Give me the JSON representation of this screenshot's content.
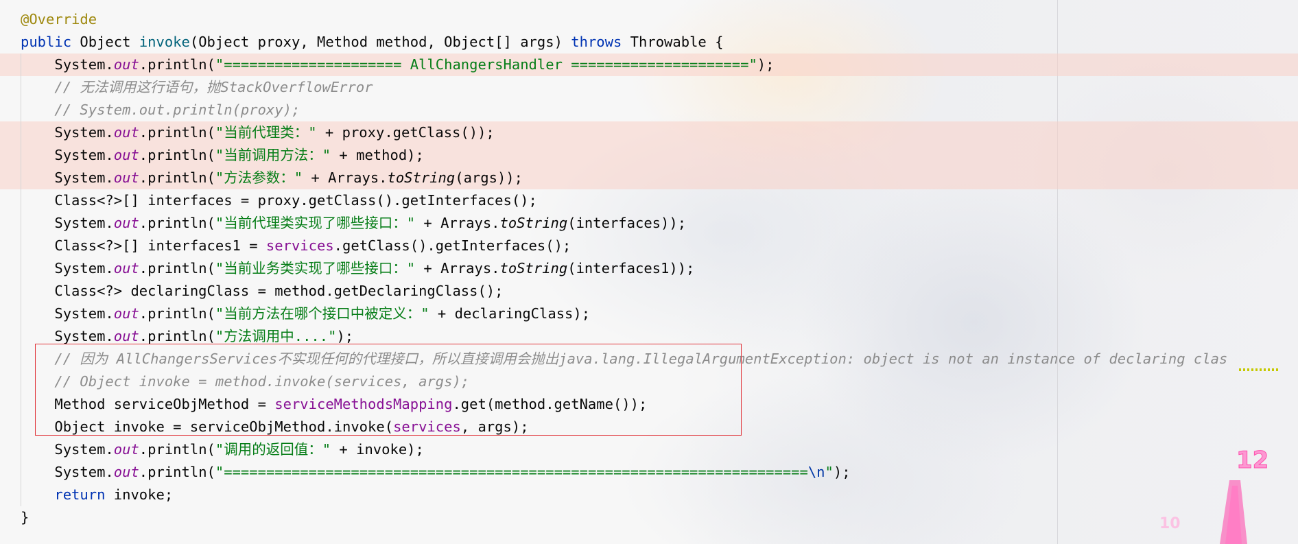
{
  "editor": {
    "lines": [
      {
        "highlighted": false,
        "tokens": [
          {
            "t": "@Override",
            "k": "ann"
          }
        ]
      },
      {
        "highlighted": false,
        "tokens": [
          {
            "t": "public",
            "k": "kw"
          },
          {
            "t": " Object ",
            "k": ""
          },
          {
            "t": "invoke",
            "k": "fn"
          },
          {
            "t": "(Object proxy, Method method, Object[] args) ",
            "k": ""
          },
          {
            "t": "throws",
            "k": "kw"
          },
          {
            "t": " Throwable {",
            "k": ""
          }
        ]
      },
      {
        "highlighted": true,
        "tokens": [
          {
            "t": "    System.",
            "k": ""
          },
          {
            "t": "out",
            "k": "static"
          },
          {
            "t": ".println(",
            "k": ""
          },
          {
            "t": "\"===================== AllChangersHandler =====================\"",
            "k": "str"
          },
          {
            "t": ");",
            "k": ""
          }
        ]
      },
      {
        "highlighted": false,
        "tokens": [
          {
            "t": "    // 无法调用这行语句，抛StackOverflowError",
            "k": "comment"
          }
        ]
      },
      {
        "highlighted": false,
        "tokens": [
          {
            "t": "    // System.out.println(proxy);",
            "k": "comment"
          }
        ]
      },
      {
        "highlighted": true,
        "tokens": [
          {
            "t": "    System.",
            "k": ""
          },
          {
            "t": "out",
            "k": "static"
          },
          {
            "t": ".println(",
            "k": ""
          },
          {
            "t": "\"当前代理类：\"",
            "k": "str"
          },
          {
            "t": " + proxy.getClass());",
            "k": ""
          }
        ]
      },
      {
        "highlighted": true,
        "tokens": [
          {
            "t": "    System.",
            "k": ""
          },
          {
            "t": "out",
            "k": "static"
          },
          {
            "t": ".println(",
            "k": ""
          },
          {
            "t": "\"当前调用方法：\"",
            "k": "str"
          },
          {
            "t": " + method);",
            "k": ""
          }
        ]
      },
      {
        "highlighted": true,
        "tokens": [
          {
            "t": "    System.",
            "k": ""
          },
          {
            "t": "out",
            "k": "static"
          },
          {
            "t": ".println(",
            "k": ""
          },
          {
            "t": "\"方法参数：\"",
            "k": "str"
          },
          {
            "t": " + Arrays.",
            "k": ""
          },
          {
            "t": "toString",
            "k": "smeth"
          },
          {
            "t": "(args));",
            "k": ""
          }
        ]
      },
      {
        "highlighted": false,
        "tokens": [
          {
            "t": "    Class<?>[] interfaces = proxy.getClass().getInterfaces();",
            "k": ""
          }
        ]
      },
      {
        "highlighted": false,
        "tokens": [
          {
            "t": "    System.",
            "k": ""
          },
          {
            "t": "out",
            "k": "static"
          },
          {
            "t": ".println(",
            "k": ""
          },
          {
            "t": "\"当前代理类实现了哪些接口：\"",
            "k": "str"
          },
          {
            "t": " + Arrays.",
            "k": ""
          },
          {
            "t": "toString",
            "k": "smeth"
          },
          {
            "t": "(interfaces));",
            "k": ""
          }
        ]
      },
      {
        "highlighted": false,
        "tokens": [
          {
            "t": "    Class<?>[] interfaces1 = ",
            "k": ""
          },
          {
            "t": "services",
            "k": "field"
          },
          {
            "t": ".getClass().getInterfaces();",
            "k": ""
          }
        ]
      },
      {
        "highlighted": false,
        "tokens": [
          {
            "t": "    System.",
            "k": ""
          },
          {
            "t": "out",
            "k": "static"
          },
          {
            "t": ".println(",
            "k": ""
          },
          {
            "t": "\"当前业务类实现了哪些接口：\"",
            "k": "str"
          },
          {
            "t": " + Arrays.",
            "k": ""
          },
          {
            "t": "toString",
            "k": "smeth"
          },
          {
            "t": "(interfaces1));",
            "k": ""
          }
        ]
      },
      {
        "highlighted": false,
        "tokens": [
          {
            "t": "    Class<?> declaringClass = method.getDeclaringClass();",
            "k": ""
          }
        ]
      },
      {
        "highlighted": false,
        "tokens": [
          {
            "t": "    System.",
            "k": ""
          },
          {
            "t": "out",
            "k": "static"
          },
          {
            "t": ".println(",
            "k": ""
          },
          {
            "t": "\"当前方法在哪个接口中被定义：\"",
            "k": "str"
          },
          {
            "t": " + declaringClass);",
            "k": ""
          }
        ]
      },
      {
        "highlighted": false,
        "tokens": [
          {
            "t": "    System.",
            "k": ""
          },
          {
            "t": "out",
            "k": "static"
          },
          {
            "t": ".println(",
            "k": ""
          },
          {
            "t": "\"方法调用中....\"",
            "k": "str"
          },
          {
            "t": ");",
            "k": ""
          }
        ]
      },
      {
        "highlighted": false,
        "tokens": [
          {
            "t": "    // 因为 AllChangersServices不实现任何的代理接口，所以直接调用会抛出java.lang.IllegalArgumentException: object is not an instance of declaring clas",
            "k": "comment"
          }
        ]
      },
      {
        "highlighted": false,
        "tokens": [
          {
            "t": "    // Object invoke = method.invoke(services, args);",
            "k": "comment"
          }
        ]
      },
      {
        "highlighted": false,
        "tokens": [
          {
            "t": "    Method serviceObjMethod = ",
            "k": ""
          },
          {
            "t": "serviceMethodsMapping",
            "k": "field"
          },
          {
            "t": ".get(method.getName());",
            "k": ""
          }
        ]
      },
      {
        "highlighted": false,
        "tokens": [
          {
            "t": "    Object invoke = serviceObjMethod.invoke(",
            "k": ""
          },
          {
            "t": "services",
            "k": "field"
          },
          {
            "t": ", args);",
            "k": ""
          }
        ]
      },
      {
        "highlighted": false,
        "tokens": [
          {
            "t": "    System.",
            "k": ""
          },
          {
            "t": "out",
            "k": "static"
          },
          {
            "t": ".println(",
            "k": ""
          },
          {
            "t": "\"调用的返回值：\"",
            "k": "str"
          },
          {
            "t": " + invoke);",
            "k": ""
          }
        ]
      },
      {
        "highlighted": false,
        "tokens": [
          {
            "t": "    System.",
            "k": ""
          },
          {
            "t": "out",
            "k": "static"
          },
          {
            "t": ".println(",
            "k": ""
          },
          {
            "t": "\"=====================================================================",
            "k": "str"
          },
          {
            "t": "\\n",
            "k": "esc"
          },
          {
            "t": "\"",
            "k": "str"
          },
          {
            "t": ");",
            "k": ""
          }
        ]
      },
      {
        "highlighted": false,
        "tokens": [
          {
            "t": "    ",
            "k": ""
          },
          {
            "t": "return",
            "k": "kw"
          },
          {
            "t": " invoke;",
            "k": ""
          }
        ]
      },
      {
        "highlighted": false,
        "tokens": [
          {
            "t": "}",
            "k": ""
          }
        ]
      }
    ]
  },
  "decoration": {
    "clock_numbers": [
      "12",
      "10"
    ],
    "accent_color": "#ff3fa6"
  },
  "colors": {
    "keyword": "#0033b3",
    "function": "#00627a",
    "string": "#067d17",
    "field": "#871094",
    "comment": "#8c8c8c",
    "annotation": "#9e880d",
    "line_highlight": "#facdc3",
    "selection_border": "#e0343a"
  }
}
